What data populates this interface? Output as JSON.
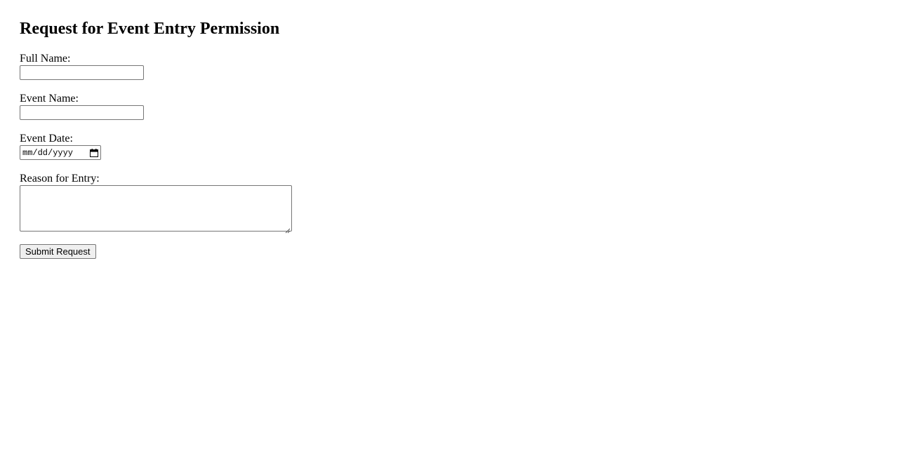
{
  "form": {
    "title": "Request for Event Entry Permission",
    "full_name": {
      "label": "Full Name:",
      "value": ""
    },
    "event_name": {
      "label": "Event Name:",
      "value": ""
    },
    "event_date": {
      "label": "Event Date:",
      "placeholder": "mm/dd/yyyy",
      "icon": "calendar-icon"
    },
    "reason": {
      "label": "Reason for Entry:",
      "value": ""
    },
    "submit_label": "Submit Request"
  }
}
